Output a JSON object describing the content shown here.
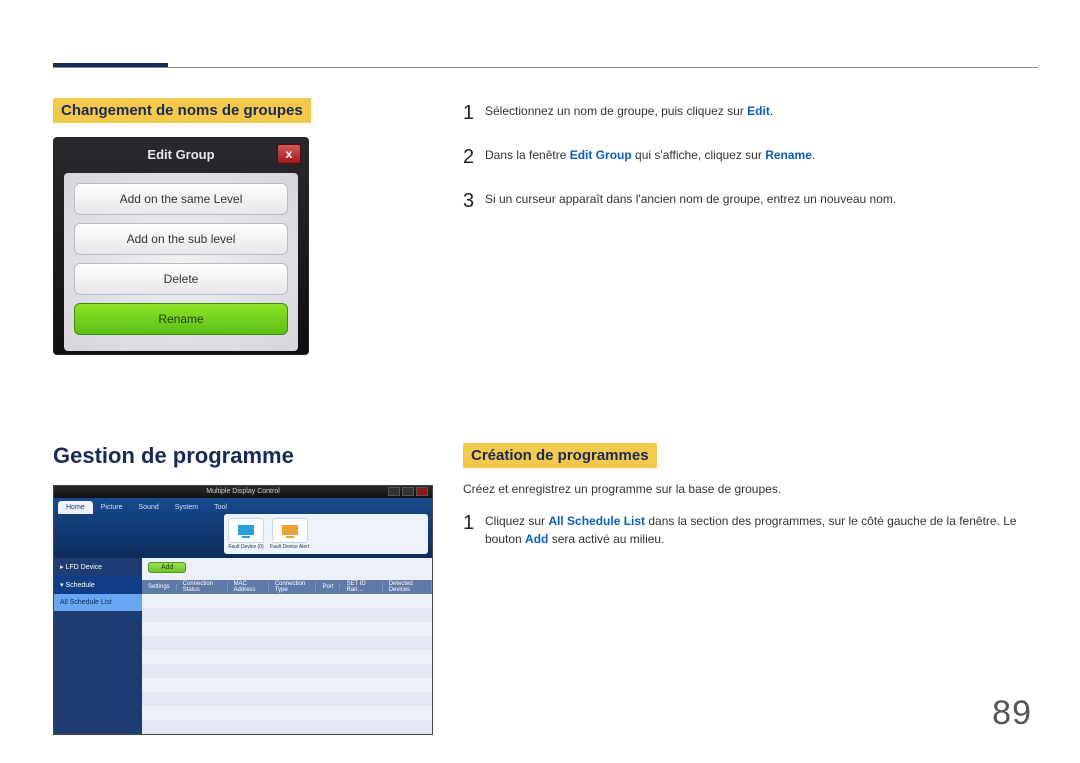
{
  "page_number": "89",
  "top": {
    "left_heading": "Changement de noms de groupes",
    "dialog": {
      "title": "Edit Group",
      "buttons": {
        "b1": "Add on the same Level",
        "b2": "Add on the sub level",
        "b3": "Delete",
        "b4": "Rename"
      }
    },
    "steps": {
      "s1_pre": "Sélectionnez un nom de groupe, puis cliquez sur ",
      "s1_b": "Edit",
      "s1_post": ".",
      "s2_pre": "Dans la fenêtre ",
      "s2_b1": "Edit Group",
      "s2_mid": " qui s'affiche, cliquez sur ",
      "s2_b2": "Rename",
      "s2_post": ".",
      "s3": "Si un curseur apparaît dans l'ancien nom de groupe, entrez un nouveau nom."
    }
  },
  "bottom": {
    "left_heading": "Gestion de programme",
    "app": {
      "title": "Multiple Display Control",
      "tabs": {
        "t1": "Home",
        "t2": "Picture",
        "t3": "Sound",
        "t4": "System",
        "t5": "Tool"
      },
      "ribbon_labels": {
        "r1": "Fault Device (0)",
        "r2": "Fault Device Alert"
      },
      "sidebar": {
        "s1": "LFD Device",
        "s2": "Schedule",
        "s3": "All Schedule List"
      },
      "add_label": "Add",
      "grid_headers": {
        "g1": "Settings",
        "g2": "Connection Status",
        "g3": "MAC Address",
        "g4": "Connection Type",
        "g5": "Port",
        "g6": "SET ID Ran…",
        "g7": "Detected Devices"
      }
    },
    "right_heading": "Création de programmes",
    "intro": "Créez et enregistrez un programme sur la base de groupes.",
    "step1_pre": "Cliquez sur ",
    "step1_b1": "All Schedule List",
    "step1_mid": " dans la section des programmes, sur le côté gauche de la fenêtre. Le bouton ",
    "step1_b2": "Add",
    "step1_post": " sera activé au milieu."
  }
}
